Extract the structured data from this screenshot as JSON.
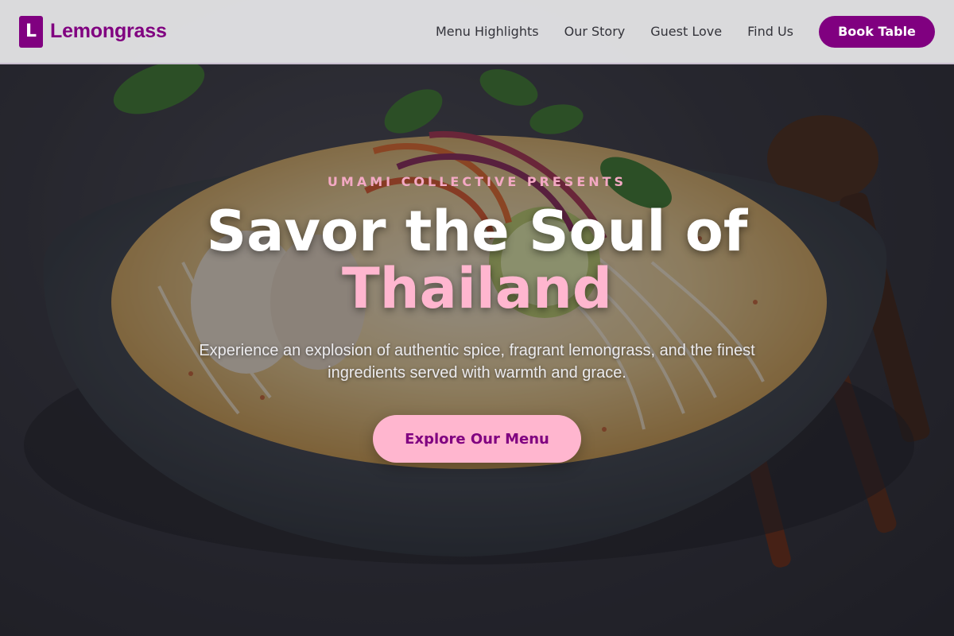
{
  "colors": {
    "brand": "#800080",
    "accent_pink": "#ffb6cf",
    "eyebrow_pink": "#f4a9c4",
    "nav_bg": "#e2e2e4"
  },
  "navbar": {
    "logo_letter": "L",
    "brand_name": "Lemongrass",
    "links": [
      {
        "label": "Menu Highlights"
      },
      {
        "label": "Our Story"
      },
      {
        "label": "Guest Love"
      },
      {
        "label": "Find Us"
      }
    ],
    "cta_label": "Book Table"
  },
  "hero": {
    "background_image": "thai-noodle-bowl-photo",
    "eyebrow": "UMAMI COLLECTIVE PRESENTS",
    "headline_line1": "Savor the Soul of",
    "headline_accent": "Thailand",
    "subtext": "Experience an explosion of authentic spice, fragrant lemongrass, and the finest ingredients served with warmth and grace.",
    "cta_label": "Explore Our Menu"
  }
}
